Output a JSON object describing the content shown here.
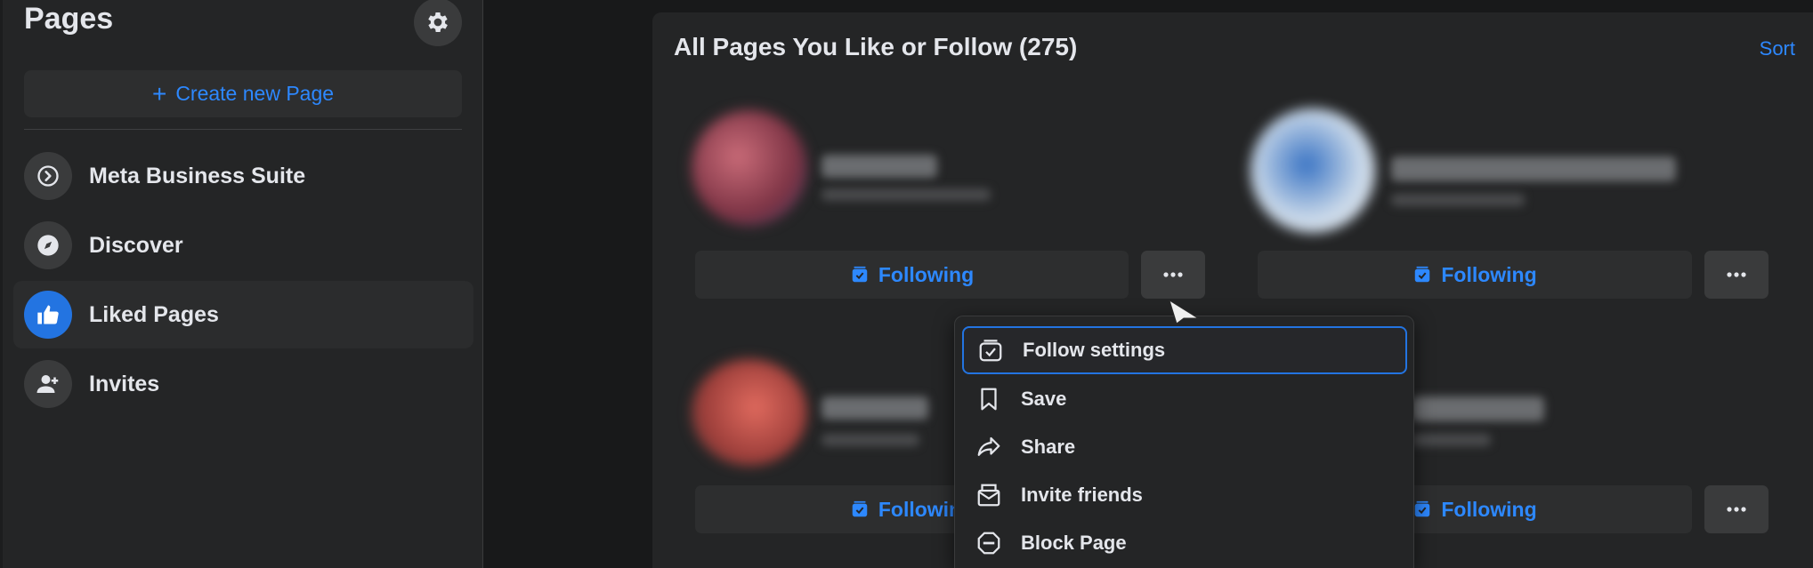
{
  "sidebar": {
    "title": "Pages",
    "settings_icon": "gear-icon",
    "create_button": "Create new Page",
    "items": [
      {
        "label": "Meta Business Suite",
        "icon": "business-suite-icon"
      },
      {
        "label": "Discover",
        "icon": "compass-icon"
      },
      {
        "label": "Liked Pages",
        "icon": "thumbs-up-icon",
        "active": true
      },
      {
        "label": "Invites",
        "icon": "add-person-icon"
      }
    ]
  },
  "main": {
    "title": "All Pages You Like or Follow (275)",
    "sort_label": "Sort",
    "pages": [
      {
        "button_label": "Following"
      },
      {
        "button_label": "Following"
      },
      {
        "button_label": "Following"
      },
      {
        "button_label": "Following"
      }
    ]
  },
  "menu": {
    "items": [
      {
        "label": "Follow settings",
        "icon": "follow-settings-icon",
        "focused": true
      },
      {
        "label": "Save",
        "icon": "bookmark-icon"
      },
      {
        "label": "Share",
        "icon": "share-arrow-icon"
      },
      {
        "label": "Invite friends",
        "icon": "envelope-icon"
      },
      {
        "label": "Block Page",
        "icon": "block-icon"
      }
    ]
  },
  "colors": {
    "accent": "#2d88ff",
    "background": "#18191a",
    "surface": "#242526",
    "button": "#3a3b3c"
  }
}
